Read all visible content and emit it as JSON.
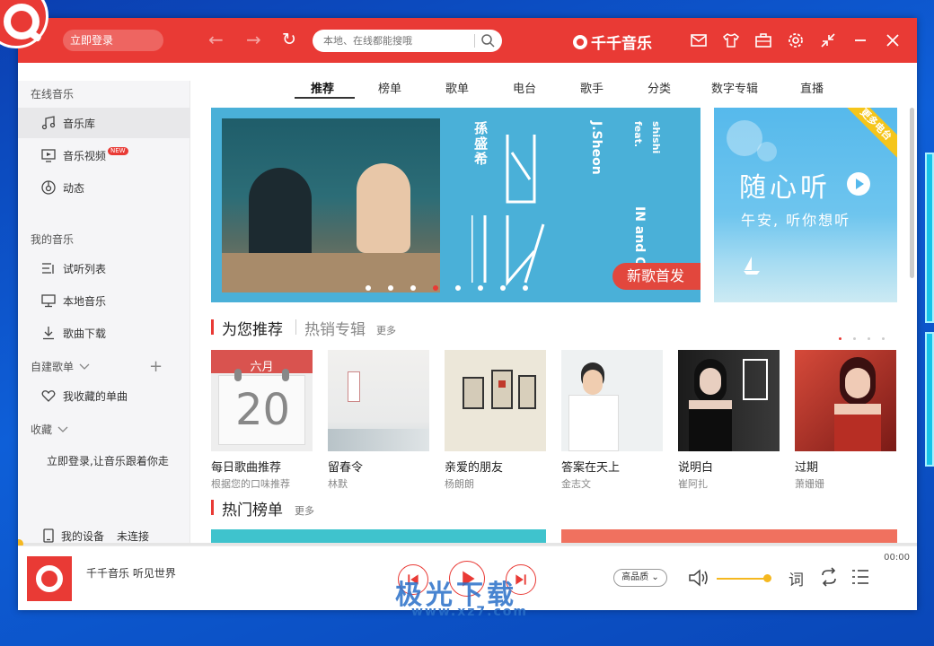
{
  "header": {
    "login_label": "立即登录",
    "search_placeholder": "本地、在线都能搜哦",
    "brand_name": "千千音乐",
    "accent_color": "#e93a35"
  },
  "sidebar": {
    "online_music_heading": "在线音乐",
    "items_online": [
      {
        "label": "音乐库",
        "icon": "music-note-icon"
      },
      {
        "label": "音乐视频",
        "icon": "video-icon",
        "badge": "NEW"
      },
      {
        "label": "动态",
        "icon": "disc-icon"
      }
    ],
    "my_music_heading": "我的音乐",
    "items_my": [
      {
        "label": "试听列表",
        "icon": "playlist-icon"
      },
      {
        "label": "本地音乐",
        "icon": "monitor-icon"
      },
      {
        "label": "歌曲下载",
        "icon": "download-icon"
      }
    ],
    "custom_playlist_heading": "自建歌单",
    "favorite_songs": "我收藏的单曲",
    "collection_heading": "收藏",
    "login_tip": "立即登录,让音乐跟着你走",
    "device_label": "我的设备",
    "device_status": "未连接"
  },
  "tabs": [
    "推荐",
    "榜单",
    "歌单",
    "电台",
    "歌手",
    "分类",
    "数字专辑",
    "直播"
  ],
  "banner": {
    "artist_cn": "孫盛希",
    "artist_en": "J.Sheon",
    "feat": "feat.",
    "feat_artist": "shishi",
    "song": "IN and OUT",
    "cta": "新歌首发",
    "side_title": "随心听",
    "side_subtitle": "午安, 听你想听",
    "side_ribbon": "更多电台"
  },
  "recommend": {
    "title": "为您推荐",
    "alt_title": "热销专辑",
    "more": "更多",
    "cards": [
      {
        "title": "每日歌曲推荐",
        "sub": "根据您的口味推荐",
        "month": "六月",
        "day": "20"
      },
      {
        "title": "留春令",
        "sub": "林默"
      },
      {
        "title": "亲爱的朋友",
        "sub": "杨朗朗"
      },
      {
        "title": "答案在天上",
        "sub": "金志文"
      },
      {
        "title": "说明白",
        "sub": "崔阿扎"
      },
      {
        "title": "过期",
        "sub": "萧姗姗"
      }
    ]
  },
  "hot": {
    "title": "热门榜单",
    "more": "更多"
  },
  "player": {
    "title": "千千音乐 听见世界",
    "time": "00:00",
    "quality": "高品质",
    "lyric_btn": "词"
  },
  "watermark": {
    "text": "极光下载",
    "url": "www.xz7.com"
  }
}
